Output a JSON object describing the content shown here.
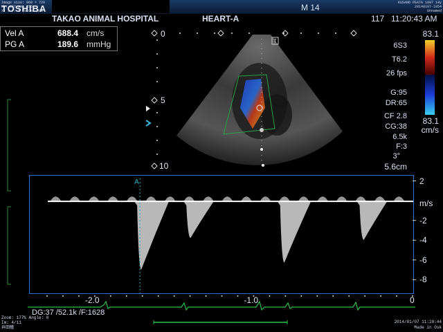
{
  "header": {
    "brand": "TOSHIBA",
    "info_line1": "Image size: 960 × 720",
    "info_line2": "WL: 127 WW: 255",
    "info_line3": "X: 1 Y: 1  Value: RGB",
    "hospital": "TAKAO ANIMAL HOSPITAL",
    "exam": "HEART-A",
    "mode": "M 14",
    "patient_line1": "KUSANO PEATA  1997  14y",
    "patient_line2": "20140107-1054",
    "patient_line3": "Unnamed",
    "frame_no": "117",
    "time": "11:20:43 AM"
  },
  "measurements": [
    {
      "label": "Vel  A",
      "value": "688.4",
      "unit": "cm/s"
    },
    {
      "label": "PG  A",
      "value": "189.6",
      "unit": "mmHg"
    }
  ],
  "depth_marks": [
    "0",
    "5",
    "10"
  ],
  "probe_marker": "T",
  "right_panel": {
    "color_max": "83.1",
    "probe": "6S3",
    "freq": "T6.2",
    "fps": "26 fps",
    "gain": "G:95",
    "dr": "DR:65",
    "cf": "CF 2.8",
    "cg": "CG:38",
    "prf": "6.5k",
    "filter": "F:3",
    "color_min": "83.1",
    "color_unit": "cm/s",
    "angle": "3°",
    "depth": "5.6cm"
  },
  "spectral": {
    "y_ticks": [
      "2",
      "m/s",
      "-2",
      "-4",
      "-6",
      "-8"
    ],
    "y_values": [
      2,
      -2,
      -4,
      -6,
      -8
    ],
    "ylim": [
      2.6,
      -9.3
    ],
    "x_ticks": [
      "-2.0",
      "-1.0",
      "0"
    ],
    "cursor_label": "A",
    "peaks": [
      {
        "t": -1.72,
        "v": -6.9
      },
      {
        "t": -1.41,
        "v": -3.7
      },
      {
        "t": -0.82,
        "v": -6.2
      },
      {
        "t": -0.32,
        "v": -3.9
      }
    ],
    "xlim": [
      -2.3,
      0.0
    ]
  },
  "footer": {
    "dg": "DG:37",
    "sample": "/52.1k",
    "filter": "/F:1628",
    "zoom": "Zoom: 177%  Angle: 0",
    "image": "Im: 4/11",
    "operator": "井田瞳",
    "date": "2014/01/07  11:20:44",
    "made": "Made in Osk"
  }
}
